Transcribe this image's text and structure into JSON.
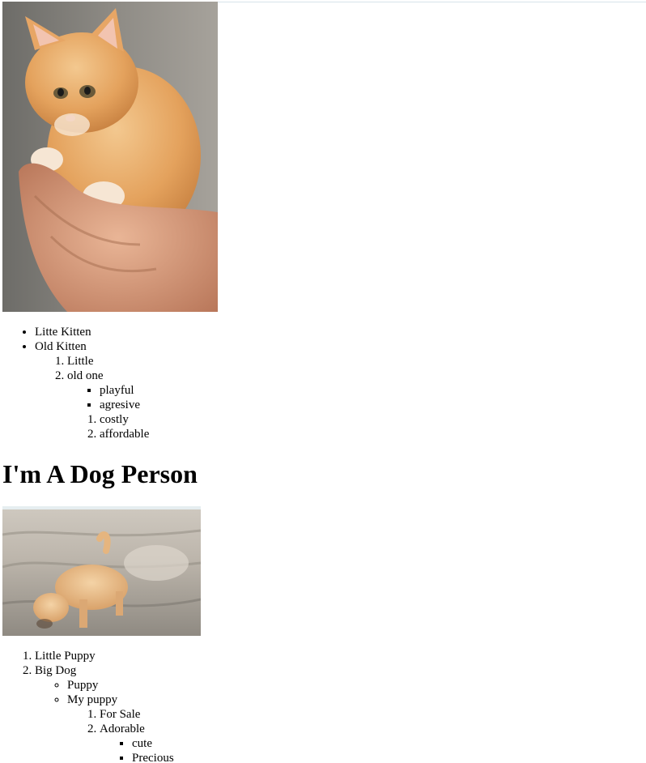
{
  "cat_section": {
    "photo_alt": "kitten held in hands",
    "list": {
      "items": [
        "Litte Kitten",
        "Old Kitten"
      ],
      "sub": [
        "Little",
        "old one"
      ],
      "sub_sub_square": [
        "playful",
        "agresive"
      ],
      "sub_sub_decimal": [
        "costly",
        "affordable"
      ]
    }
  },
  "dog_section": {
    "heading": "I'm A Dog Person",
    "photo_alt": "puppy digging in sand",
    "list": {
      "items": [
        "Little Puppy",
        "Big Dog"
      ],
      "sub": [
        "Puppy",
        "My puppy"
      ],
      "sub_sub": [
        "For Sale",
        "Adorable"
      ],
      "sub_sub_sub": [
        "cute",
        "Precious"
      ]
    }
  }
}
